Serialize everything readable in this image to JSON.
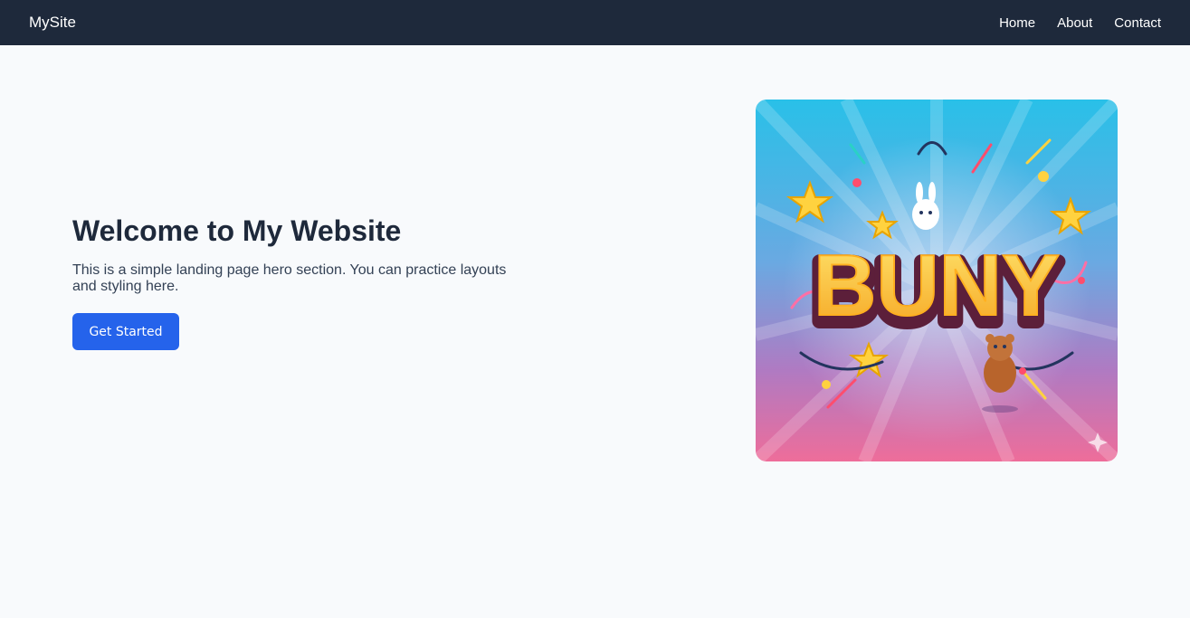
{
  "nav": {
    "brand": "MySite",
    "links": [
      "Home",
      "About",
      "Contact"
    ]
  },
  "hero": {
    "title": "Welcome to My Website",
    "subtitle": "This is a simple landing page hero section. You can practice layouts and styling here.",
    "cta_label": "Get Started",
    "image_text": "BUNY"
  },
  "colors": {
    "navbar": "#1e293b",
    "page_background": "#f8fafc",
    "button": "#2563eb",
    "title": "#1e293b"
  }
}
